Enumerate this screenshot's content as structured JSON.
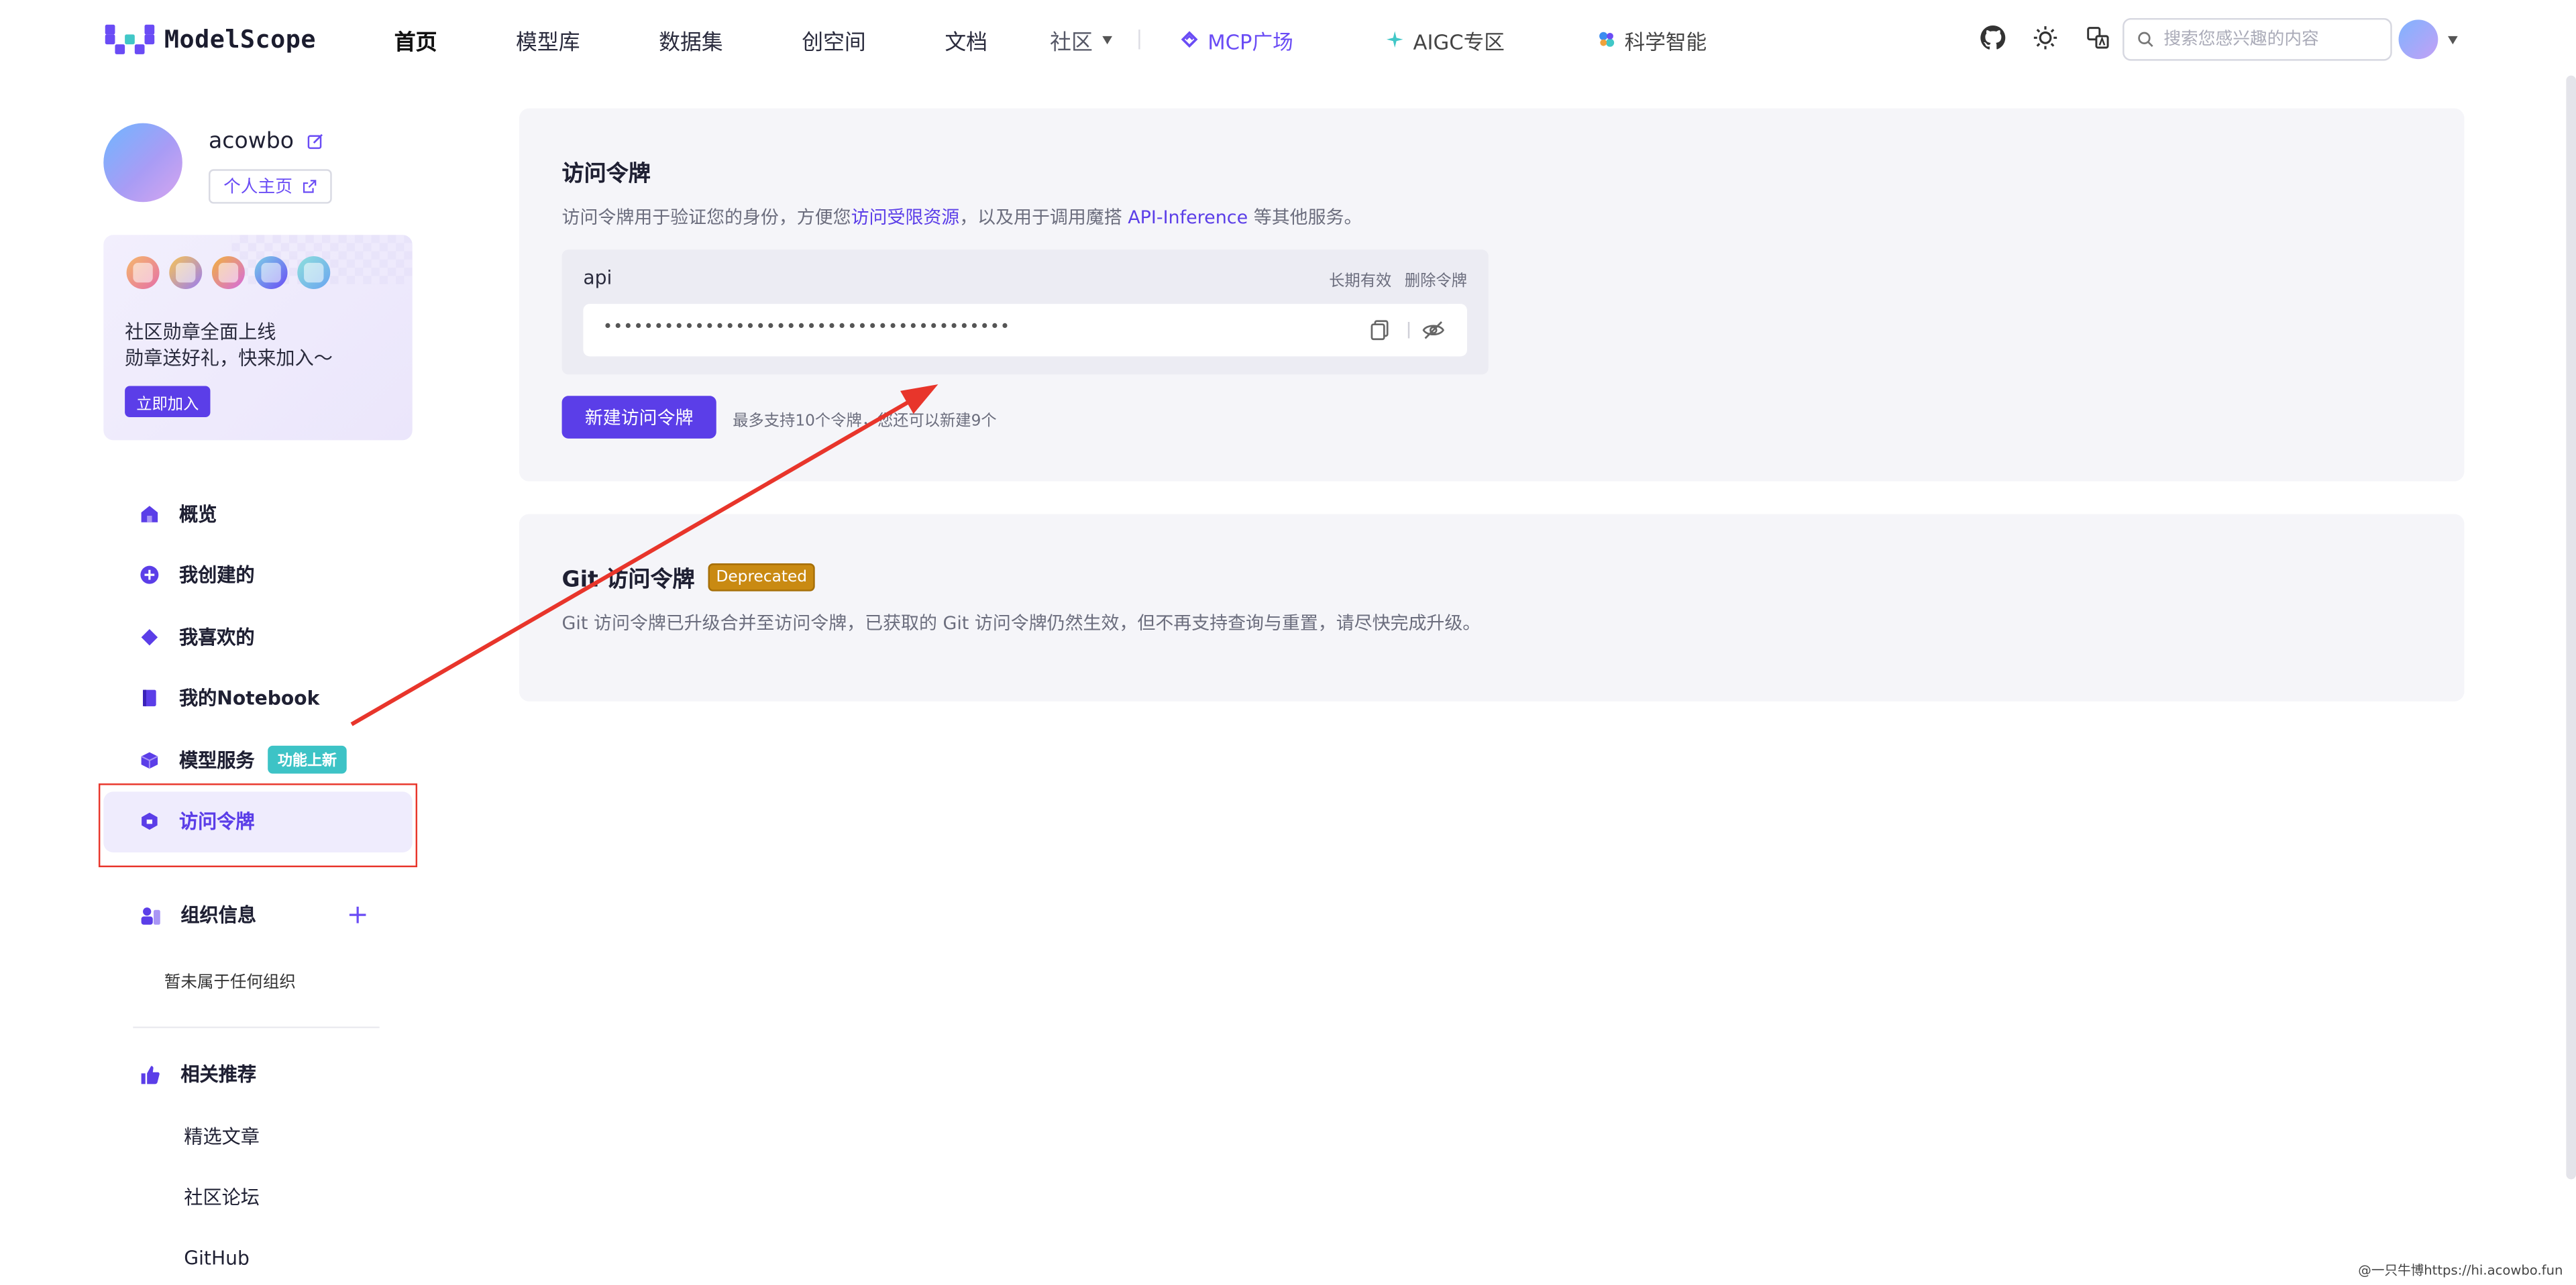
{
  "colors": {
    "accent": "#5b3ee8",
    "red_annotation": "#e8352b",
    "new_tag": "#3dc3c6",
    "deprecated": "#c98a12"
  },
  "nav": {
    "logo_text": "ModelScope",
    "links": [
      "首页",
      "模型库",
      "数据集",
      "创空间",
      "文档"
    ],
    "community": "社区",
    "mcp": "MCP广场",
    "aigc": "AIGC专区",
    "science": "科学智能",
    "search_placeholder": "搜索您感兴趣的内容",
    "icons": [
      "github-icon",
      "theme-icon",
      "language-icon"
    ]
  },
  "profile": {
    "username": "acowbo",
    "homepage_label": "个人主页"
  },
  "badge_card": {
    "line1": "社区勋章全面上线",
    "line2": "勋章送好礼，快来加入～",
    "button": "立即加入"
  },
  "sidebar": {
    "items": [
      {
        "label": "概览",
        "icon": "home-icon"
      },
      {
        "label": "我创建的",
        "icon": "create-icon"
      },
      {
        "label": "我喜欢的",
        "icon": "like-icon"
      },
      {
        "label": "我的Notebook",
        "icon": "notebook-icon"
      },
      {
        "label": "模型服务",
        "icon": "cube-icon",
        "tag": "功能上新"
      },
      {
        "label": "访问令牌",
        "icon": "shield-icon",
        "active": true
      }
    ],
    "org_title": "组织信息",
    "org_empty": "暂未属于任何组织",
    "rec_title": "相关推荐",
    "rec_items": [
      "精选文章",
      "社区论坛",
      "GitHub"
    ]
  },
  "access_token": {
    "title": "访问令牌",
    "desc_pre": "访问令牌用于验证您的身份，方便您",
    "desc_link1": "访问受限资源",
    "desc_mid": "，以及用于调用魔搭 ",
    "desc_link2": "API-Inference",
    "desc_post": " 等其他服务。",
    "token_name": "api",
    "validity": "长期有效",
    "delete": "删除令牌",
    "token_masked": "••••••••••••••••••••••••••••••••••••••••",
    "new_button": "新建访问令牌",
    "limit_note": "最多支持10个令牌，您还可以新建9个"
  },
  "git_token": {
    "title": "Git 访问令牌",
    "badge": "Deprecated",
    "desc": "Git 访问令牌已升级合并至访问令牌，已获取的 Git 访问令牌仍然生效，但不再支持查询与重置，请尽快完成升级。"
  },
  "watermark": "@一只牛博https://hi.acowbo.fun"
}
